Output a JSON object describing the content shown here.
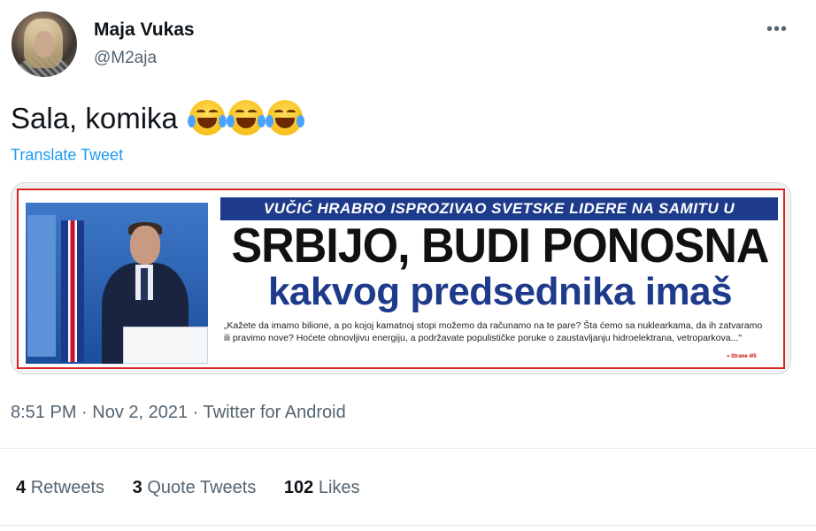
{
  "author": {
    "name": "Maja Vukas",
    "handle": "@M2aja"
  },
  "more_label": "•••",
  "tweet": {
    "text": "Sala, komika",
    "emojis": [
      "face-with-tears-of-joy-icon",
      "face-with-tears-of-joy-icon",
      "face-with-tears-of-joy-icon"
    ],
    "translate_label": "Translate Tweet"
  },
  "media": {
    "kicker": "VUČIĆ HRABRO ISPROZIVAO SVETSKE LIDERE NA SAMITU U GLAZGOVU",
    "headline_line1": "SRBIJO, BUDI PONOSNA",
    "headline_line2": "kakvog predsednika imaš",
    "quote": "„Kažete da imamo bilione, a po kojoj kamatnoj stopi možemo da računamo na te pare? Šta ćemo sa nuklearkama, da ih zatvaramo ili pravimo nove? Hoćete obnovljivu energiju, a podržavate populističke poruke o zaustavljanju hidroelektrana, vetroparkova...\"",
    "page_ref": "» Strane 4/5"
  },
  "meta": {
    "line": "8:51 PM · Nov 2, 2021 · Twitter for Android"
  },
  "stats": {
    "retweets": {
      "count": "4",
      "label": "Retweets"
    },
    "quotes": {
      "count": "3",
      "label": "Quote Tweets"
    },
    "likes": {
      "count": "102",
      "label": "Likes"
    }
  },
  "colors": {
    "link": "#1d9bf0",
    "secondary": "#536471",
    "primary": "#0f1419",
    "paper_blue": "#1e3a8a"
  }
}
